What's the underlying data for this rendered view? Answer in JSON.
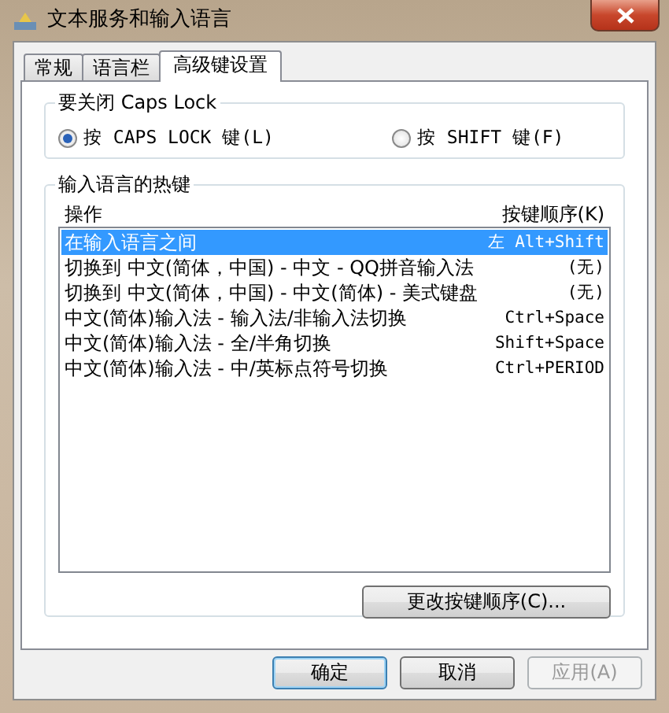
{
  "window": {
    "title": "文本服务和输入语言"
  },
  "tabs": [
    {
      "label": "常规",
      "selected": false
    },
    {
      "label": "语言栏",
      "selected": false
    },
    {
      "label": "高级键设置",
      "selected": true
    }
  ],
  "caps_lock": {
    "title": "要关闭 Caps Lock",
    "options": [
      {
        "label": "按 CAPS LOCK 键(L)",
        "selected": true
      },
      {
        "label": "按 SHIFT 键(F)",
        "selected": false
      }
    ]
  },
  "hotkeys": {
    "title": "输入语言的热键",
    "columns": [
      "操作",
      "按键顺序(K)"
    ],
    "rows": [
      {
        "action": "在输入语言之间",
        "keys": "左 Alt+Shift",
        "selected": true
      },
      {
        "action": "切换到 中文(简体，中国) - 中文 - QQ拼音输入法",
        "keys": "(无)",
        "selected": false
      },
      {
        "action": "切换到 中文(简体，中国) - 中文(简体) - 美式键盘",
        "keys": "(无)",
        "selected": false
      },
      {
        "action": "中文(简体)输入法 - 输入法/非输入法切换",
        "keys": "Ctrl+Space",
        "selected": false
      },
      {
        "action": "中文(简体)输入法 - 全/半角切换",
        "keys": "Shift+Space",
        "selected": false
      },
      {
        "action": "中文(简体)输入法 - 中/英标点符号切换",
        "keys": "Ctrl+PERIOD",
        "selected": false
      }
    ],
    "change_button": "更改按键顺序(C)..."
  },
  "buttons": [
    {
      "label": "确定",
      "kind": "default",
      "disabled": false
    },
    {
      "label": "取消",
      "kind": "normal",
      "disabled": false
    },
    {
      "label": "应用(A)",
      "kind": "normal",
      "disabled": true
    }
  ]
}
